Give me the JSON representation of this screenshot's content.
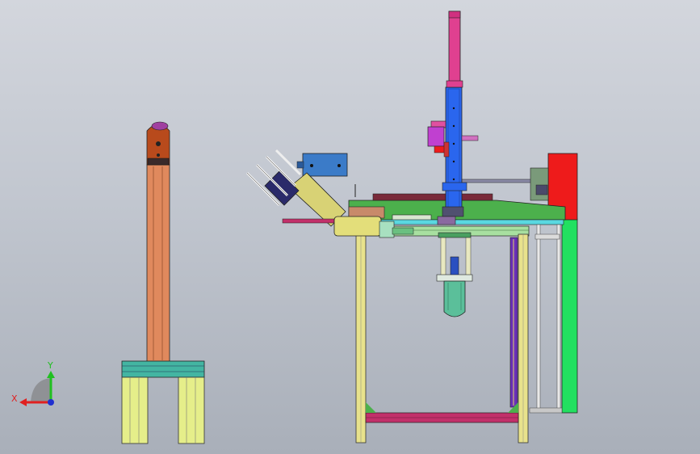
{
  "triad": {
    "x_label": "X",
    "y_label": "Y",
    "x_color": "#e02020",
    "y_color": "#20c020",
    "z_color": "#2030d0"
  },
  "palette": {
    "pillar": "#e0895d",
    "pillar_head": "#b84a1c",
    "pillar_cap": "#a040a0",
    "stand_top": "#43b5a2",
    "stand_legs": "#e5ee8a",
    "frame_legs": "#e8e28c",
    "plate_green": "#4cb04c",
    "panel_green": "#22e060",
    "panel_red": "#ee1b1b",
    "column_blue": "#2a66ee",
    "rod_pink": "#e04090",
    "gripper_magenta": "#c040d0",
    "block_blue": "#3b7bc8",
    "chute": "#d8d275",
    "motor_teal": "#5bbf9a",
    "crossbar": "#c2306a",
    "strut_purple": "#6a2fb8"
  }
}
